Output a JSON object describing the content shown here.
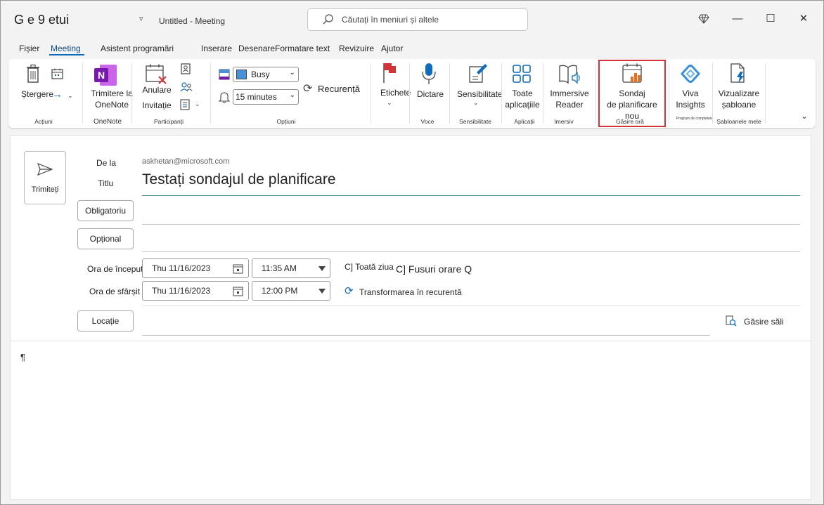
{
  "titlebar": {
    "app_title": "G e 9 etui",
    "qat_arrow": "▿",
    "doc_name": "Untitled  -  Meeting",
    "search_placeholder": "Căutați în meniuri și altele",
    "premium_icon": "diamond-icon",
    "minimize": "—",
    "maximize": "☐",
    "close": "✕"
  },
  "tabs": [
    "Fișier",
    "Meeting",
    "Asistent programări",
    "Inserare",
    "Desenare",
    "Formatare text",
    "Revizuire",
    "Ajutor"
  ],
  "active_tab": "Meeting",
  "ribbon": {
    "actions": {
      "delete": "Ștergere",
      "forward_arrow": "→",
      "label": "Acțiuni"
    },
    "onenote": {
      "send_line1": "Trimitere la",
      "send_line2": "OneNote",
      "label": "OneNote"
    },
    "participants": {
      "cancel_line1": "Anulare",
      "cancel_line2": "Invitație",
      "label": "Participanți"
    },
    "options": {
      "busy": "Busy",
      "reminder": "15 minutes",
      "recurrence": "Recurență",
      "label": "Opțiuni",
      "busy_color": "#4a90d9"
    },
    "tags": {
      "label": "Etichete"
    },
    "voice": {
      "dictate": "Dictare",
      "label": "Voce"
    },
    "sensitivity": {
      "button": "Sensibilitate",
      "label": "Sensibilitate"
    },
    "apps": {
      "line1": "Toate",
      "line2": "aplicațiile",
      "label": "Aplicații"
    },
    "immersive": {
      "line1": "Immersive",
      "line2": "Reader",
      "label": "Imersiv"
    },
    "find_time": {
      "line1": "Sondaj",
      "line2": "de planificare nou",
      "label": "Găsire oră"
    },
    "viva": {
      "line1": "Viva",
      "line2": "Insights",
      "label": "Program de completare"
    },
    "templates": {
      "line1": "Vizualizare",
      "line2": "șabloane",
      "label": "Șabloanele mele"
    }
  },
  "compose": {
    "send": "Trimiteți",
    "from_label": "De la",
    "from_value": "askhetan@microsoft.com",
    "title_label": "Titlu",
    "title_value": "Testați sondajul de planificare",
    "required": "Obligatoriu",
    "optional": "Opțional",
    "start_label": "Ora de început",
    "end_label": "Ora de sfârșit",
    "start_date": "Thu 11/16/2023",
    "end_date": "Thu 11/16/2023",
    "start_time": "11:35 AM",
    "end_time": "12:00 PM",
    "all_day": "C] Toată ziua",
    "time_zones": "C] Fusuri orare Q",
    "make_recurring": "Transformarea în recurentă",
    "location": "Locație",
    "find_rooms": "Găsire săli",
    "body_mark": "¶"
  }
}
